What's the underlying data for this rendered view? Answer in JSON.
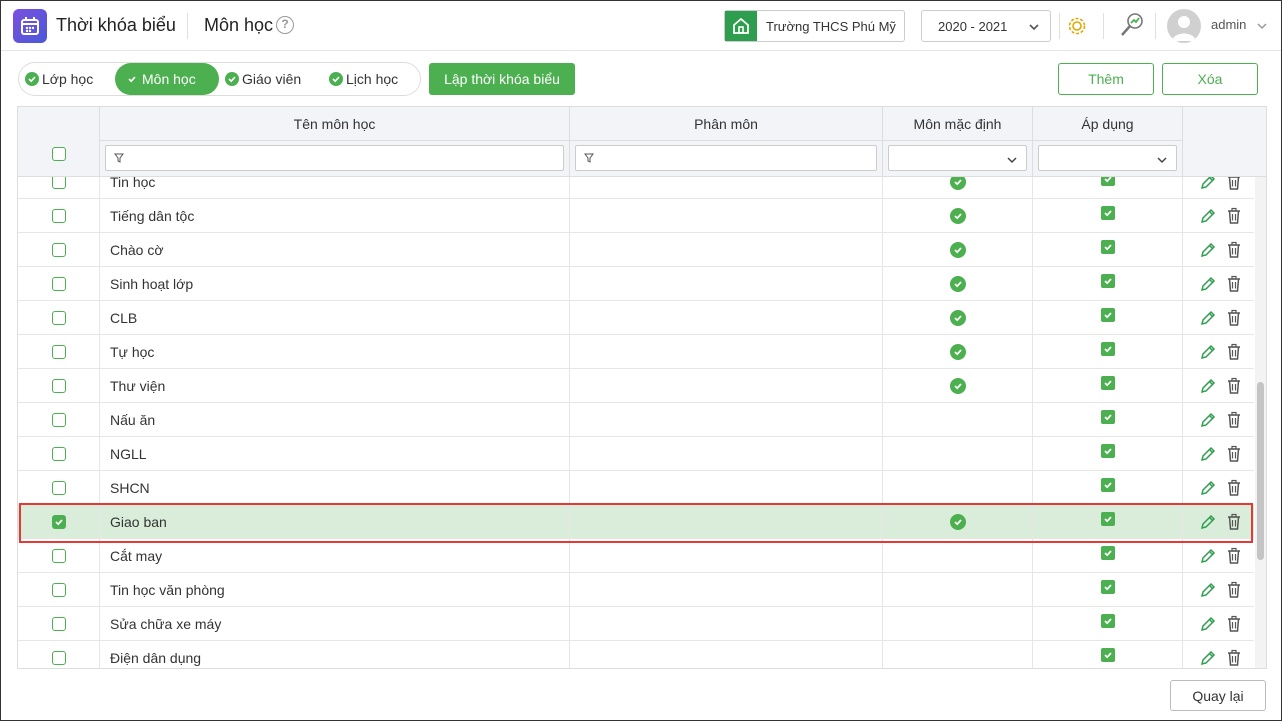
{
  "header": {
    "app_title": "Thời khóa biểu",
    "page_title": "Môn học",
    "help": "?",
    "school": "Trường THCS Phú Mỹ",
    "year": "2020 - 2021",
    "user": "admin"
  },
  "tabs": [
    {
      "label": "Lớp học",
      "active": false
    },
    {
      "label": "Môn học",
      "active": true
    },
    {
      "label": "Giáo viên",
      "active": false
    },
    {
      "label": "Lịch học",
      "active": false
    }
  ],
  "buttons": {
    "build": "Lập thời khóa biểu",
    "add": "Thêm",
    "delete": "Xóa",
    "back": "Quay lại"
  },
  "table": {
    "columns": {
      "name": "Tên môn học",
      "sub": "Phân môn",
      "default": "Môn mặc định",
      "apply": "Áp dụng"
    },
    "rows": [
      {
        "name": "Tin học",
        "default": true,
        "apply": true,
        "selected": false
      },
      {
        "name": "Tiếng dân tộc",
        "default": true,
        "apply": true,
        "selected": false
      },
      {
        "name": "Chào cờ",
        "default": true,
        "apply": true,
        "selected": false
      },
      {
        "name": "Sinh hoạt lớp",
        "default": true,
        "apply": true,
        "selected": false
      },
      {
        "name": "CLB",
        "default": true,
        "apply": true,
        "selected": false
      },
      {
        "name": "Tự học",
        "default": true,
        "apply": true,
        "selected": false
      },
      {
        "name": "Thư viện",
        "default": true,
        "apply": true,
        "selected": false
      },
      {
        "name": "Nấu ăn",
        "default": false,
        "apply": true,
        "selected": false
      },
      {
        "name": "NGLL",
        "default": false,
        "apply": true,
        "selected": false
      },
      {
        "name": "SHCN",
        "default": false,
        "apply": true,
        "selected": false
      },
      {
        "name": "Giao ban",
        "default": true,
        "apply": true,
        "selected": true
      },
      {
        "name": "Cắt may",
        "default": false,
        "apply": true,
        "selected": false
      },
      {
        "name": "Tin học văn phòng",
        "default": false,
        "apply": true,
        "selected": false
      },
      {
        "name": "Sửa chữa xe máy",
        "default": false,
        "apply": true,
        "selected": false
      },
      {
        "name": "Điện dân dụng",
        "default": false,
        "apply": true,
        "selected": false
      }
    ]
  },
  "colors": {
    "accent": "#4caf50",
    "selected_row": "#d9edda",
    "highlight": "#e53935"
  }
}
